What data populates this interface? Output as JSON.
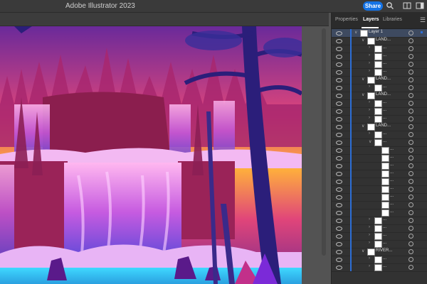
{
  "titlebar": {
    "app_title": "Adobe Illustrator 2023",
    "share_label": "Share",
    "icons": [
      "search-icon",
      "arrange-documents-icon",
      "workspace-icon"
    ]
  },
  "panel": {
    "tabs": [
      {
        "label": "Properties",
        "active": false
      },
      {
        "label": "Layers",
        "active": true
      },
      {
        "label": "Libraries",
        "active": false
      }
    ],
    "layers": [
      {
        "depth": 0,
        "label": "Layer 1",
        "expanded": true,
        "selected": true
      },
      {
        "depth": 1,
        "label": "LAND...",
        "expanded": true
      },
      {
        "depth": 2,
        "label": "..."
      },
      {
        "depth": 2,
        "label": "..."
      },
      {
        "depth": 2,
        "label": "..."
      },
      {
        "depth": 2,
        "label": "..."
      },
      {
        "depth": 1,
        "label": "LAND...",
        "expanded": true
      },
      {
        "depth": 2,
        "label": "..."
      },
      {
        "depth": 1,
        "label": "LAND...",
        "expanded": true
      },
      {
        "depth": 2,
        "label": "..."
      },
      {
        "depth": 2,
        "label": "..."
      },
      {
        "depth": 2,
        "label": "..."
      },
      {
        "depth": 1,
        "label": "LAND...",
        "expanded": true
      },
      {
        "depth": 2,
        "label": "..."
      },
      {
        "depth": 2,
        "label": "...",
        "expanded": true
      },
      {
        "depth": 3,
        "label": "..."
      },
      {
        "depth": 3,
        "label": "..."
      },
      {
        "depth": 3,
        "label": "..."
      },
      {
        "depth": 3,
        "label": "..."
      },
      {
        "depth": 3,
        "label": "..."
      },
      {
        "depth": 3,
        "label": "..."
      },
      {
        "depth": 3,
        "label": "..."
      },
      {
        "depth": 3,
        "label": "..."
      },
      {
        "depth": 3,
        "label": "..."
      },
      {
        "depth": 2,
        "label": "..."
      },
      {
        "depth": 2,
        "label": "..."
      },
      {
        "depth": 2,
        "label": "..."
      },
      {
        "depth": 2,
        "label": "..."
      },
      {
        "depth": 1,
        "label": "RIVER...",
        "expanded": true
      },
      {
        "depth": 2,
        "label": "..."
      },
      {
        "depth": 2,
        "label": "..."
      }
    ]
  }
}
